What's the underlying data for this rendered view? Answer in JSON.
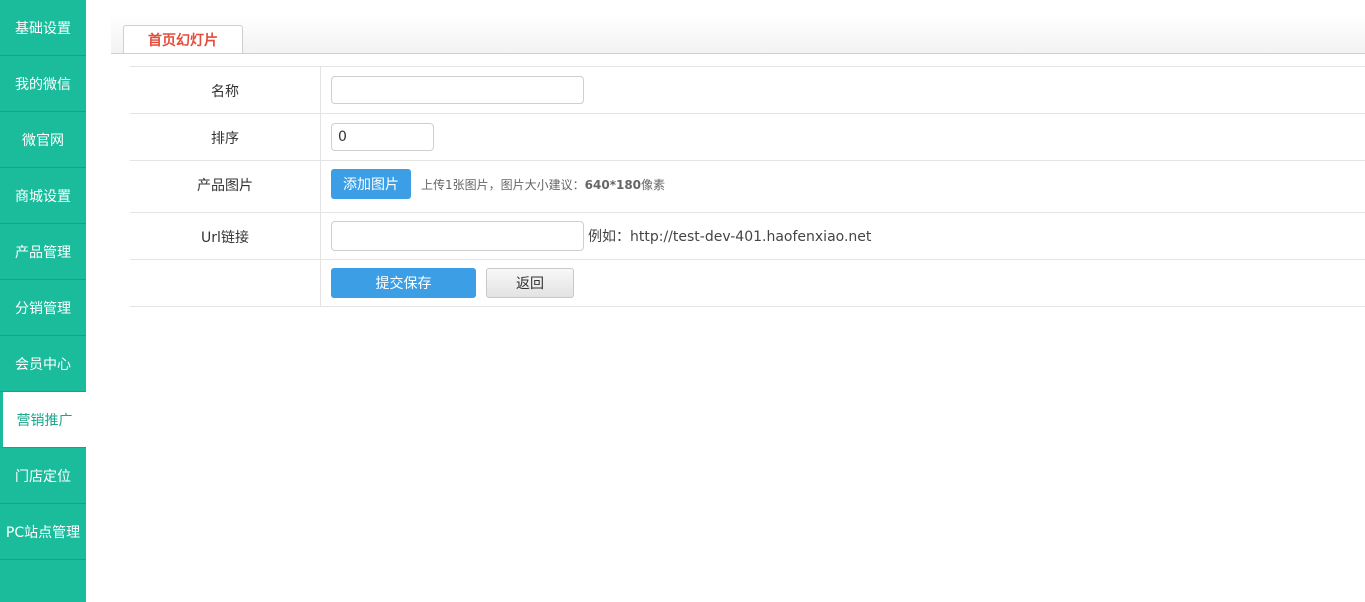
{
  "sidebar": {
    "items": [
      {
        "label": "基础设置"
      },
      {
        "label": "我的微信"
      },
      {
        "label": "微官网"
      },
      {
        "label": "商城设置"
      },
      {
        "label": "产品管理"
      },
      {
        "label": "分销管理"
      },
      {
        "label": "会员中心"
      },
      {
        "label": "营销推广"
      },
      {
        "label": "门店定位"
      },
      {
        "label": "PC站点管理"
      }
    ],
    "active_index": 7
  },
  "tab": {
    "label": "首页幻灯片"
  },
  "form": {
    "name_label": "名称",
    "name_value": "",
    "sort_label": "排序",
    "sort_value": "0",
    "image_label": "产品图片",
    "add_image_button": "添加图片",
    "image_hint_prefix": "上传1张图片，图片大小建议：",
    "image_hint_size": "640*180",
    "image_hint_suffix": "像素",
    "url_label": "Url链接",
    "url_value": "",
    "url_example_prefix": "例如：",
    "url_example": "http://test-dev-401.haofenxiao.net",
    "submit_button": "提交保存",
    "back_button": "返回"
  },
  "colors": {
    "sidebar_bg": "#1abc9c",
    "primary_button": "#3c9fe6",
    "tab_text": "#e64c3c"
  }
}
